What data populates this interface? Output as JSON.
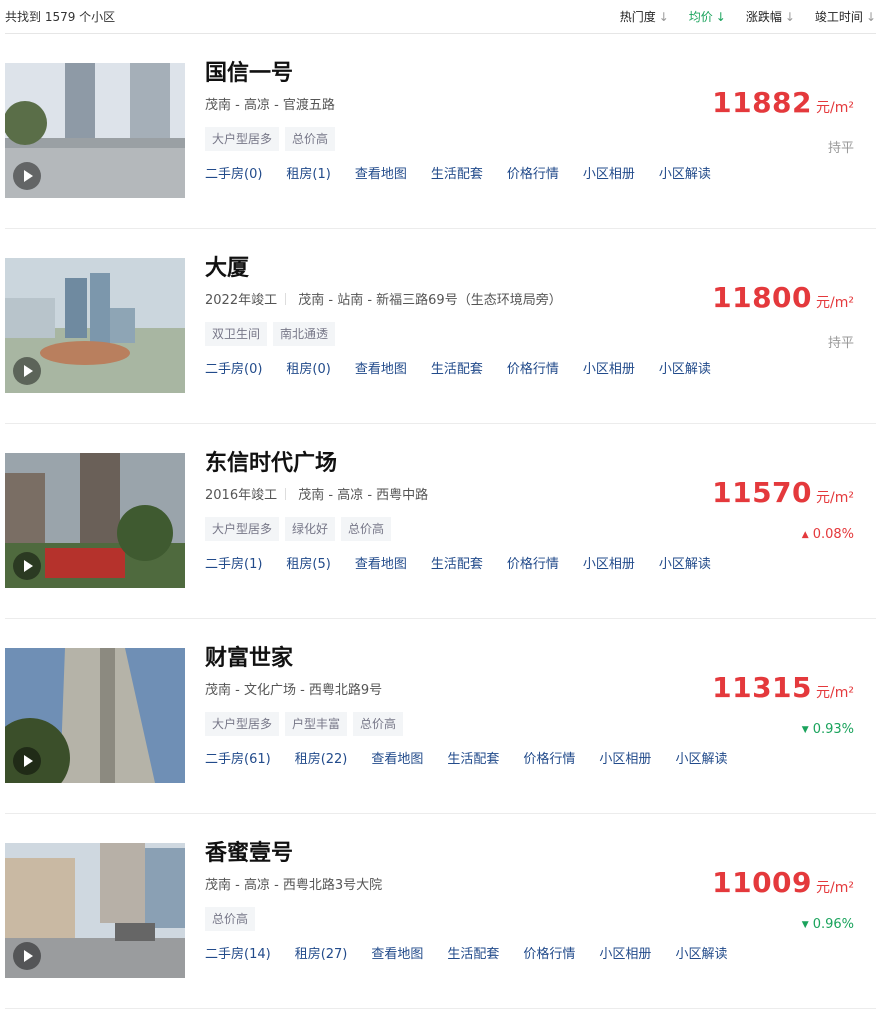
{
  "header": {
    "count_text": "共找到 1579 个小区",
    "sorts": [
      {
        "label": "热门度",
        "active": false
      },
      {
        "label": "均价",
        "active": true
      },
      {
        "label": "涨跌幅",
        "active": false
      },
      {
        "label": "竣工时间",
        "active": false
      }
    ]
  },
  "colors": {
    "price": "#e4393c",
    "up": "#e4393c",
    "down": "#1aa35c",
    "link": "#224b8b",
    "active_sort": "#1aa35c"
  },
  "items": [
    {
      "name": "国信一号",
      "year": "",
      "address": "茂南 - 高凉 - 官渡五路",
      "tags": [
        "大户型居多",
        "总价高"
      ],
      "links": [
        "二手房(0)",
        "租房(1)",
        "查看地图",
        "生活配套",
        "价格行情",
        "小区相册",
        "小区解读"
      ],
      "price": "11882",
      "unit": "元/m²",
      "change": "持平",
      "change_dir": "flat"
    },
    {
      "name": "大厦",
      "year": "2022年竣工",
      "address": "茂南 - 站南 - 新福三路69号（生态环境局旁）",
      "tags": [
        "双卫生间",
        "南北通透"
      ],
      "links": [
        "二手房(0)",
        "租房(0)",
        "查看地图",
        "生活配套",
        "价格行情",
        "小区相册",
        "小区解读"
      ],
      "price": "11800",
      "unit": "元/m²",
      "change": "持平",
      "change_dir": "flat"
    },
    {
      "name": "东信时代广场",
      "year": "2016年竣工",
      "address": "茂南 - 高凉 - 西粤中路",
      "tags": [
        "大户型居多",
        "绿化好",
        "总价高"
      ],
      "links": [
        "二手房(1)",
        "租房(5)",
        "查看地图",
        "生活配套",
        "价格行情",
        "小区相册",
        "小区解读"
      ],
      "price": "11570",
      "unit": "元/m²",
      "change": "0.08%",
      "change_dir": "up"
    },
    {
      "name": "财富世家",
      "year": "",
      "address": "茂南 - 文化广场 - 西粤北路9号",
      "tags": [
        "大户型居多",
        "户型丰富",
        "总价高"
      ],
      "links": [
        "二手房(61)",
        "租房(22)",
        "查看地图",
        "生活配套",
        "价格行情",
        "小区相册",
        "小区解读"
      ],
      "price": "11315",
      "unit": "元/m²",
      "change": "0.93%",
      "change_dir": "down"
    },
    {
      "name": "香蜜壹号",
      "year": "",
      "address": "茂南 - 高凉 - 西粤北路3号大院",
      "tags": [
        "总价高"
      ],
      "links": [
        "二手房(14)",
        "租房(27)",
        "查看地图",
        "生活配套",
        "价格行情",
        "小区相册",
        "小区解读"
      ],
      "price": "11009",
      "unit": "元/m²",
      "change": "0.96%",
      "change_dir": "down"
    }
  ]
}
